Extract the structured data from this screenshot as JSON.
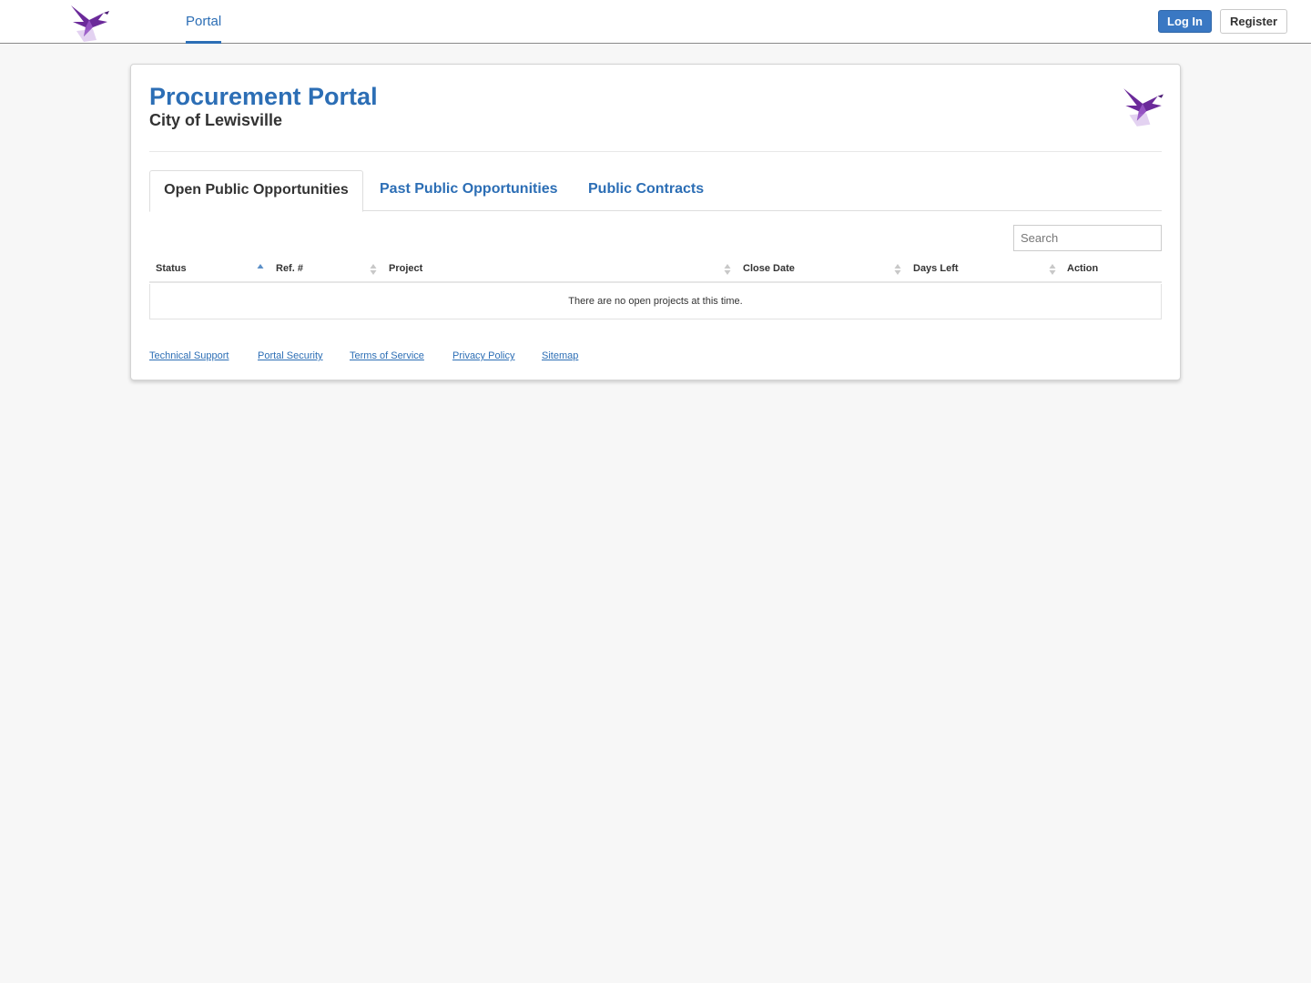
{
  "topbar": {
    "logo_icon": "purple-bird-logo-icon",
    "nav_portal": "Portal",
    "login_label": "Log In",
    "register_label": "Register"
  },
  "header": {
    "title": "Procurement Portal",
    "subtitle": "City of Lewisville"
  },
  "tabs": [
    {
      "label": "Open Public Opportunities",
      "active": true
    },
    {
      "label": "Past Public Opportunities",
      "active": false
    },
    {
      "label": "Public Contracts",
      "active": false
    }
  ],
  "search": {
    "placeholder": "Search"
  },
  "table": {
    "columns": [
      "Status",
      "Ref. #",
      "Project",
      "Close Date",
      "Days Left",
      "Action"
    ],
    "empty_message": "There are no open projects at this time."
  },
  "footer": {
    "links": [
      "Technical Support",
      "Portal Security",
      "Terms of Service",
      "Privacy Policy",
      "Sitemap"
    ]
  },
  "colors": {
    "brand_blue": "#2c6eb5",
    "bird_purple": "#6b2a9a",
    "bird_violet": "#9b59c9"
  }
}
